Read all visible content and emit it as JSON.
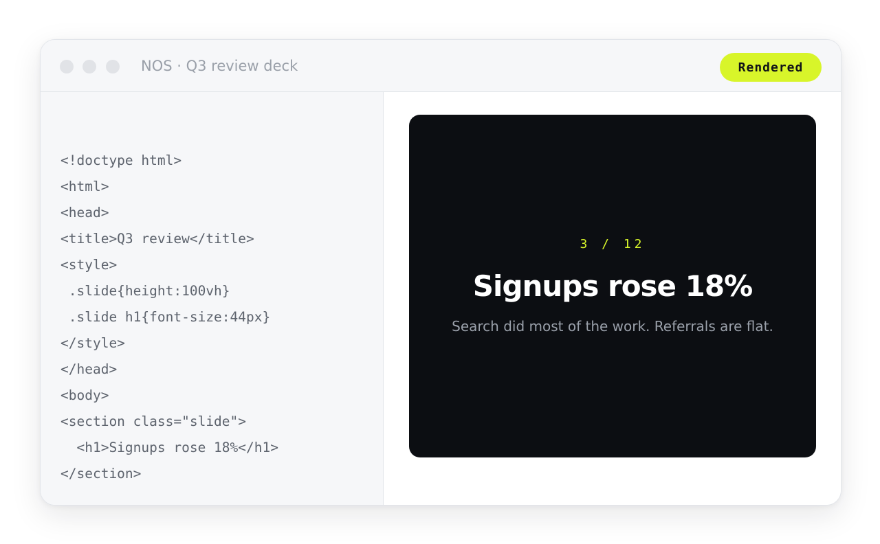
{
  "window": {
    "title": "NOS · Q3 review deck",
    "badge": "Rendered"
  },
  "code": {
    "lines": [
      "<!doctype html>",
      "<html>",
      "<head>",
      "<title>Q3 review</title>",
      "<style>",
      " .slide{height:100vh}",
      " .slide h1{font-size:44px}",
      "</style>",
      "</head>",
      "<body>",
      "<section class=\"slide\">",
      "  <h1>Signups rose 18%</h1>",
      "</section>"
    ]
  },
  "slide": {
    "counter": "3 / 12",
    "title": "Signups rose 18%",
    "subtitle": "Search did most of the work. Referrals are flat."
  },
  "colors": {
    "accent": "#d8f52a",
    "slide_background": "#0c0e12",
    "code_text": "#5d636d",
    "title_text": "#9aa0a9"
  }
}
